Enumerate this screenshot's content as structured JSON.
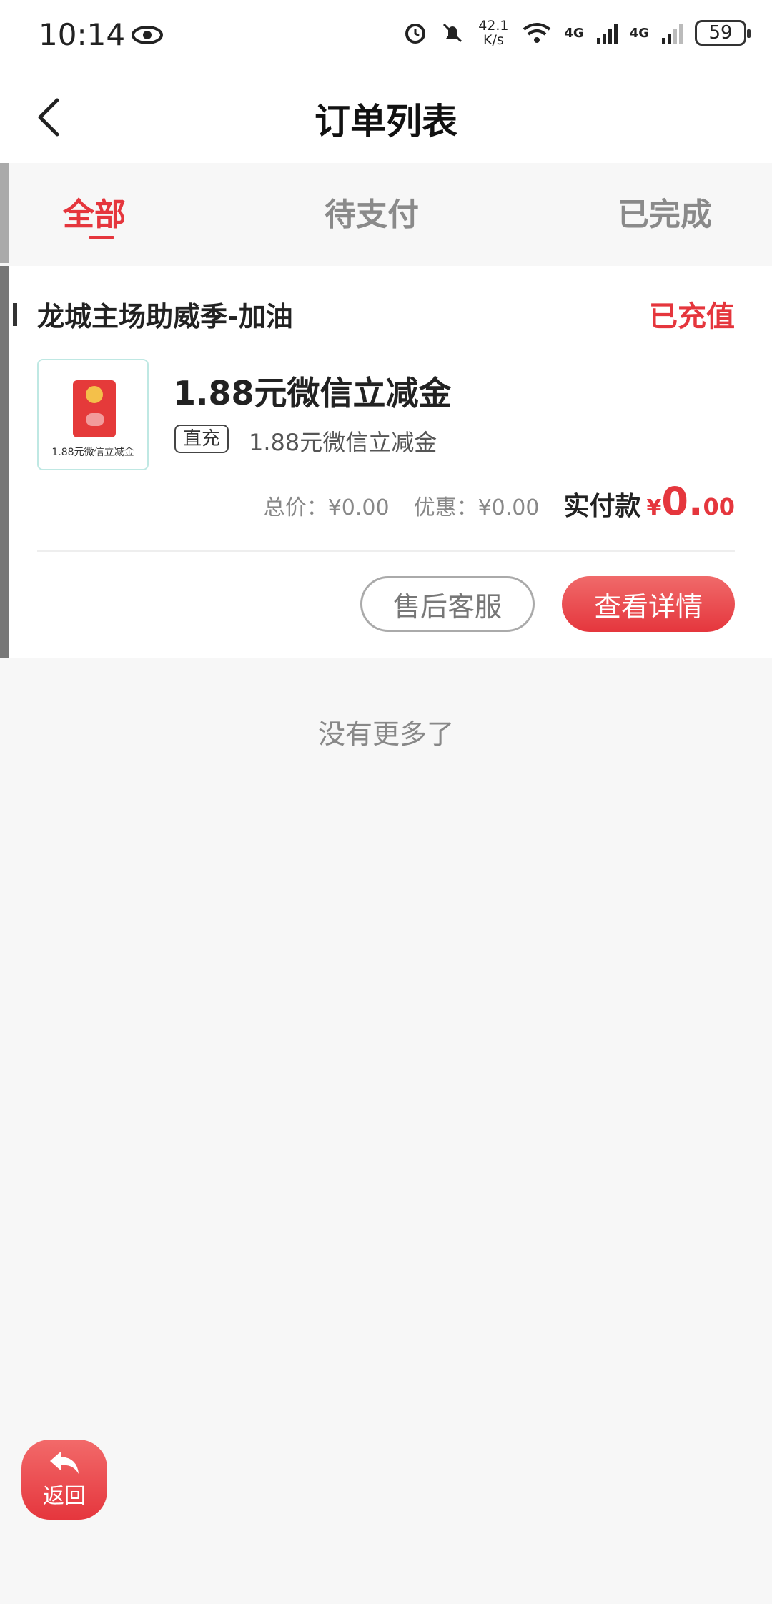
{
  "status_bar": {
    "time": "10:14",
    "speed_value": "42.1",
    "speed_unit": "K/s",
    "net_1": "4G",
    "net_2": "4G",
    "battery": "59"
  },
  "header": {
    "title": "订单列表"
  },
  "tabs": [
    {
      "label": "全部",
      "active": true
    },
    {
      "label": "待支付",
      "active": false
    },
    {
      "label": "已完成",
      "active": false
    }
  ],
  "order": {
    "shop_name": "龙城主场助威季-加油",
    "status": "已充值",
    "thumbnail_caption": "1.88元微信立减金",
    "product_title": "1.88元微信立减金",
    "tag": "直充",
    "product_sub": "1.88元微信立减金",
    "total_label": "总价：",
    "total_value": "¥0.00",
    "discount_label": "优惠：",
    "discount_value": "¥0.00",
    "paid_label": "实付款",
    "paid_currency": "¥",
    "paid_int": "0.",
    "paid_dec": "00",
    "btn_service": "售后客服",
    "btn_detail": "查看详情"
  },
  "list_footer": "没有更多了",
  "float_back": {
    "label": "返回"
  },
  "colors": {
    "accent": "#e5363d",
    "background": "#f7f7f7"
  }
}
